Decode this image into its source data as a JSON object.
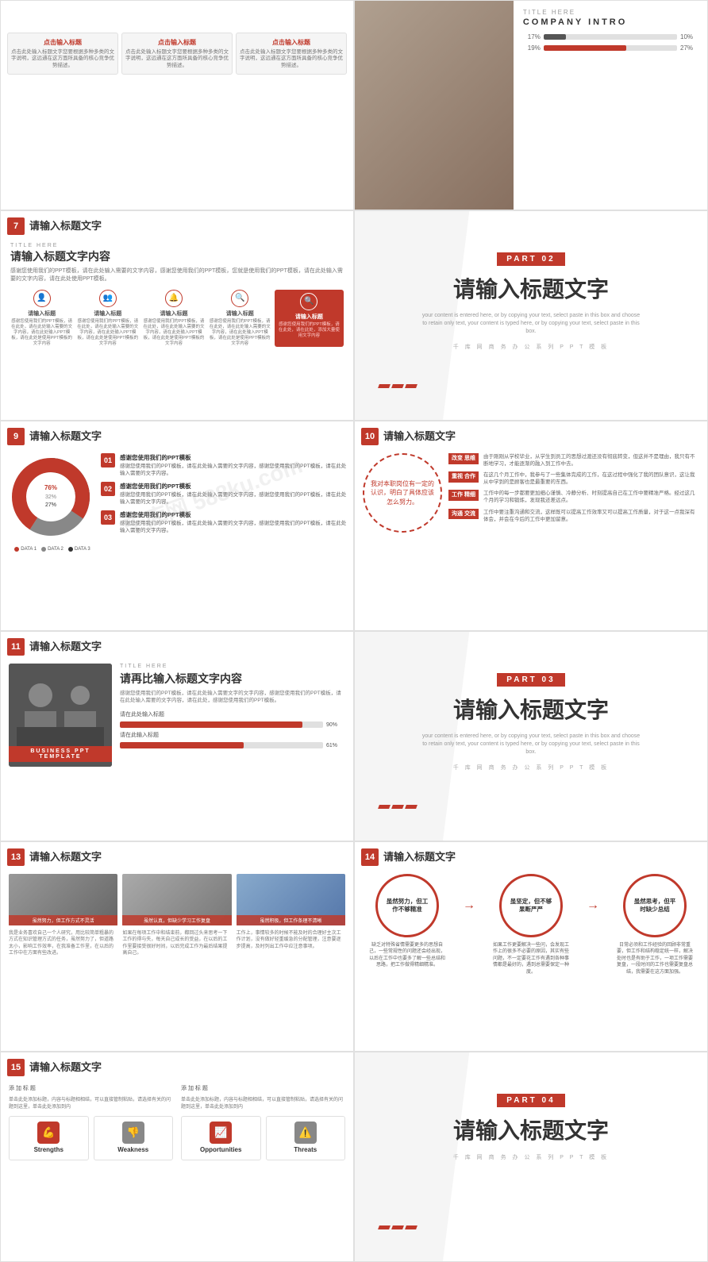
{
  "watermark": "千库网 588ku.com",
  "slides": {
    "s1": {
      "number": "",
      "cards": [
        {
          "title": "点击输入标题",
          "body": "点击此处输入标题文字您要根据多种多类的文字说明，这远通在这方面所具备的核心竞争优势描述。"
        },
        {
          "title": "点击输入标题",
          "body": "点击此处输入标题文字您要根据多种多类的文字说明，这远通在这方面所具备的核心竞争优势描述。"
        },
        {
          "title": "点击输入标题",
          "body": "点击此处输入标题文字您要根据多种多类的文字说明，这远通在这方面所具备的核心竞争优势描述。"
        }
      ]
    },
    "s2": {
      "title_here": "TITLE HERE",
      "company_intro": "COMPANY INTRO",
      "bars": [
        {
          "left_pct": "17%",
          "fill": 17,
          "right_pct": "10%"
        },
        {
          "left_pct": "19%",
          "fill": 62,
          "right_pct": "27%"
        }
      ]
    },
    "s7": {
      "number": "7",
      "slide_title": "请输入标题文字",
      "title_here": "TITLE HERE",
      "main_title": "请输入标题文字内容",
      "description": "感谢您使用我们的PPT模板，请在此处输入需要的文字内容，感谢您使用我们的PPT模板，您就是使用我们的PPT模板，请在此处输入需要的文字内容，请在此处使用PPT模板。",
      "icons": [
        {
          "label": "请输入标题",
          "text": "感谢您使用我们的PPT模板，请在此处，请在此处输入需要的文字内容，请在此处输入PPT模板，请在此处是使用PPT模板的文字内容"
        },
        {
          "label": "请输入标题",
          "text": "感谢您使用我们的PPT模板，请在此处，请在此处输入需要的文字内容，请在此处输入PPT模板，请在此处是使用PPT模板的文字内容"
        },
        {
          "label": "请输入标题",
          "text": "感谢您使用我们的PPT模板，请在此处，请在此处输入需要的文字内容，请在此处输入PPT模板，请在此处是使用PPT模板的文字内容"
        },
        {
          "label": "请输入标题",
          "text": "感谢您使用我们的PPT模板，请在此处，请在此处输入需要的文字内容，请在此处输入PPT模板，请在此处是使用PPT模板的文字内容"
        },
        {
          "label": "请输入标题",
          "text": "感谢您使用我们的PPT模板，请在此处，请在此处，添加大量使用文字内容",
          "active": true
        }
      ]
    },
    "part02": {
      "badge": "PART 02",
      "main_title": "请输入标题文字",
      "sub1": "your content is entered here, or by copying your text, select paste in this box and choose to retain only text, your content is typed here, or by copying your text, select paste in this box.",
      "footer": "千 库 网 商 务 办 公 系 列 P P T 模 板"
    },
    "s9": {
      "number": "9",
      "slide_title": "请输入标题文字",
      "donut": {
        "segments": [
          {
            "pct": 76,
            "color": "#c0392b",
            "label": "DATA 1"
          },
          {
            "pct": 32,
            "color": "#888",
            "label": "DATA 2"
          },
          {
            "pct": 27,
            "color": "#333",
            "label": "DATA 3"
          }
        ],
        "center_labels": [
          "27%",
          "32%",
          "76%"
        ]
      },
      "items": [
        {
          "num": "01",
          "title": "感谢您使用我们的PPT模板",
          "body": "感谢您使用我们的PPT模板，请在此处输入需要的文字内容，感谢您使用我们的PPT模板，请在此处输入需要的文字内容。"
        },
        {
          "num": "02",
          "title": "感谢您使用我们的PPT模板",
          "body": "感谢您使用我们的PPT模板，请在此处输入需要的文字内容，感谢您使用我们的PPT模板，请在此处输入需要的文字内容。"
        },
        {
          "num": "03",
          "title": "感谢您使用我们的PPT模板",
          "body": "感谢您使用我们的PPT模板，请在此处输入需要的文字内容，感谢您使用我们的PPT模板，请在此处输入需要的文字内容。"
        }
      ]
    },
    "s10": {
      "number": "10",
      "slide_title": "请输入标题文字",
      "center_text": "我对本职岗位有一定的认识，明白了具体应该怎么努力。",
      "items": [
        {
          "badge": "改变\n思维",
          "title": "",
          "body": "由于刚刚从学校毕业，从学生到员工的思想过渡还没有彻底转变，但这并不是理由，我只有不断地学习，才能逐渐的融入到工作中去。"
        },
        {
          "badge": "重视\n合作",
          "title": "",
          "body": "在这几个月工作中，我参与了一些集体完成的工作，在这过程中强化了我的团队意识，这让我从中学到的是顾客也是最重要的东西。"
        },
        {
          "badge": "工作\n精细",
          "title": "",
          "body": "工作中的每一步都要更加细心谨慎、冷静分析、时刻提高自己在工作中要精准严格。经过这几个月的学习和锻炼，发现我还差远点。"
        },
        {
          "badge": "沟通\n交流",
          "title": "",
          "body": "工作中要注重沟通和交流，这样既可以提高工作效率又可以提高工作质量，对于这一点我深有体会，并会在今后的工作中更加留意。"
        }
      ]
    },
    "s11": {
      "number": "11",
      "slide_title": "请输入标题文字",
      "title_here": "TITLE HERE",
      "main_title": "请再比输入标题文字内容",
      "desc": "感谢您使用我们的PPT模板，请在此处输入需要文字的文字内容，感谢您使用我们的PPT模板，请在此处输入需要的文字内容，请在此处，感谢您使用我们的PPT模板。",
      "image_label": "BUSINESS PPT TEMPLATE",
      "sub_label": "请在此处输入标题",
      "progress_bars": [
        {
          "pct": 90,
          "label": "90%"
        },
        {
          "pct": 61,
          "label": "61%"
        }
      ],
      "progress_label2": "请在此输入标题"
    },
    "part03": {
      "badge": "PART 03",
      "main_title": "请输入标题文字",
      "sub1": "your content is entered here, or by copying your text, select paste in this box and choose to retain only text, your content is typed here, or by copying your text, select paste in this box.",
      "footer": "千 库 网 商 务 办 公 系 列 P P T 模 板"
    },
    "s13": {
      "number": "13",
      "slide_title": "请输入标题文字",
      "images": [
        {
          "label": "虽然努力，但工作方式不灵活"
        },
        {
          "label": "虽然认真，但缺少学习工作复盘"
        },
        {
          "label": "虽然积极，但工作条理不清晰"
        }
      ],
      "cards": [
        {
          "title": "",
          "text": "我是业务喜欢自己一个人研究，用比较简单粗暴的方式在知识管理方式的任务，虽然努力了，但道路太小，影响工作效率，在我准备工作里，在以后的工作中在方面有些改进。"
        },
        {
          "title": "",
          "text": "如果在每项工作中和结束前，都回过头来思考一下工作的得与失，每天自己成长的受益，在以后的工作里要接受很好时间，以后完成工作为最后结果提高自己。"
        },
        {
          "title": "",
          "text": "工作上，事情较多的时候不能及时的合理好主次工作计划，没有做好轻重缓急的分配管理，注意要逐步提高，及时列出工作中应注意事项。"
        }
      ]
    },
    "s14": {
      "number": "14",
      "slide_title": "请输入标题文字",
      "circles": [
        {
          "text": "虽然努力，但工作不够精准",
          "desc": "缺乏对特殊省情需要更多的思想自己，一些常规性的问题还会经出现，以后在工作中也要多了解一些总结和思路，把工作做得精细精准。"
        },
        {
          "text": "虽坚定，但不够果断严严",
          "desc": "如果工作更要解决一些问，会发现工作上的很多不必要的原因，其实有些问题，不一定要花工作有遇到各种事情都是最好的，遇到总需要保定一种度。"
        },
        {
          "text": "虽然思考，但平时缺少总结",
          "desc": "日常必须和工作经验的回顾非常重要，但工作和结构稳定统一样，解决处时也是有助于工作，一项工作需要复盘，一段时间的工作也需要复盘总结，我需要在这方面加强。"
        }
      ]
    },
    "s15": {
      "number": "15",
      "slide_title": "请输入标题文字",
      "add_label1": "添 加 标 题",
      "add_desc1": "单击此处添加标题，内容与标题相相结，可以直接管制粘贴，请选择有关的问题到这里，单击此处添加到内",
      "swot": [
        {
          "key": "Strengths",
          "icon": "💪",
          "type": "strength"
        },
        {
          "key": "Weakness",
          "icon": "👎",
          "type": "weakness"
        }
      ],
      "add_label2": "添 加 标 题",
      "add_desc2": "单击此处添加标题，内容与标题相相结，可以直接管制粘贴，请选择有关的问题到这里，单击此处添加到内"
    },
    "part04": {
      "badge": "PART 04",
      "main_title": "请输入标题文字",
      "footer": "千 库 网 商 务 办 公 系 列 P P T 模 板"
    }
  }
}
